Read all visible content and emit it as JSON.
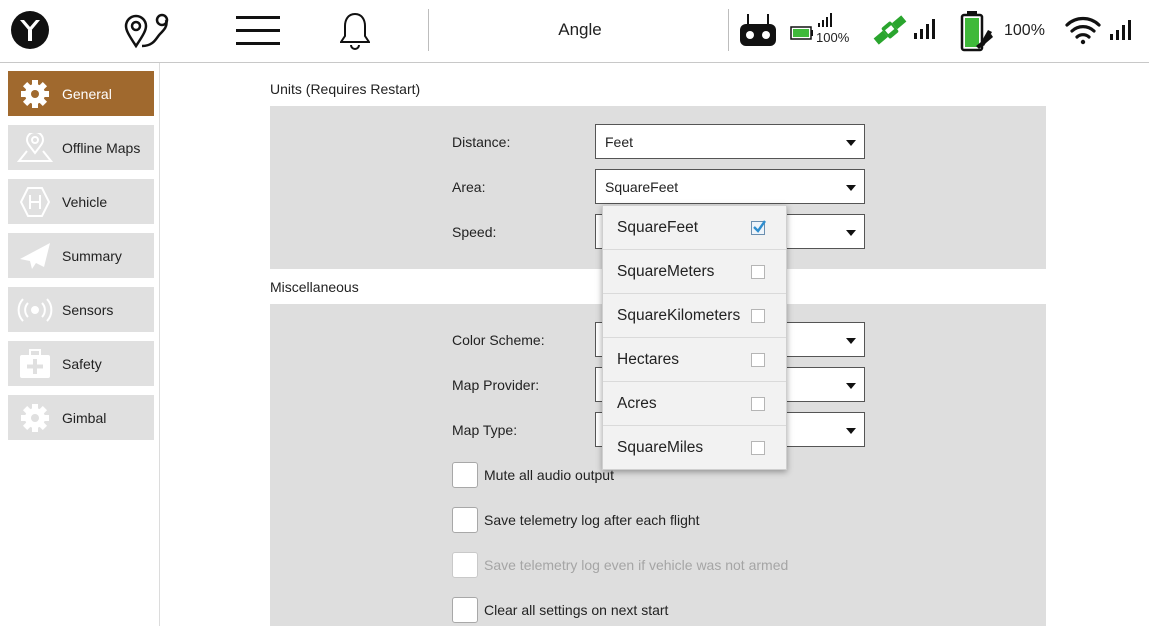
{
  "toolbar": {
    "title": "Angle",
    "rc_battery": "100%",
    "battery": "100%",
    "icons": [
      "app-logo-icon",
      "plan-route-icon",
      "menu-icon",
      "bell-icon",
      "rc-controller-icon",
      "gps-satellite-icon",
      "battery-icon",
      "wifi-icon"
    ]
  },
  "sidebar": {
    "items": [
      {
        "label": "General",
        "icon": "gear-icon",
        "active": true
      },
      {
        "label": "Offline Maps",
        "icon": "map-pin-icon"
      },
      {
        "label": "Vehicle",
        "icon": "helipad-icon"
      },
      {
        "label": "Summary",
        "icon": "paper-plane-icon"
      },
      {
        "label": "Sensors",
        "icon": "radio-wave-icon"
      },
      {
        "label": "Safety",
        "icon": "first-aid-icon"
      },
      {
        "label": "Gimbal",
        "icon": "gear-icon"
      }
    ]
  },
  "units": {
    "title": "Units (Requires Restart)",
    "distance_label": "Distance:",
    "distance_value": "Feet",
    "area_label": "Area:",
    "area_value": "SquareFeet",
    "speed_label": "Speed:",
    "speed_value": ""
  },
  "misc": {
    "title": "Miscellaneous",
    "color_scheme_label": "Color Scheme:",
    "map_provider_label": "Map Provider:",
    "map_type_label": "Map Type:",
    "checks": [
      {
        "label": "Mute all audio output",
        "checked": false,
        "disabled": false
      },
      {
        "label": "Save telemetry log after each flight",
        "checked": false,
        "disabled": false
      },
      {
        "label": "Save telemetry log even if vehicle was not armed",
        "checked": false,
        "disabled": true
      },
      {
        "label": "Clear all settings on next start",
        "checked": false,
        "disabled": false
      }
    ]
  },
  "area_dropdown": {
    "options": [
      {
        "label": "SquareFeet",
        "checked": true
      },
      {
        "label": "SquareMeters",
        "checked": false
      },
      {
        "label": "SquareKilometers",
        "checked": false
      },
      {
        "label": "Hectares",
        "checked": false
      },
      {
        "label": "Acres",
        "checked": false
      },
      {
        "label": "SquareMiles",
        "checked": false
      }
    ]
  },
  "colors": {
    "accent": "#a0692e",
    "panel": "#dedede",
    "sidebar_button": "#e0e0e0",
    "battery_green": "#3fb93a"
  }
}
